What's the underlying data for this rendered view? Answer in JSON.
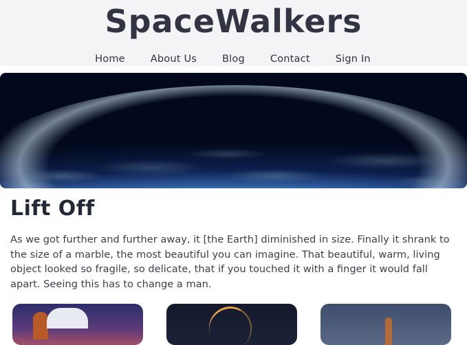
{
  "header": {
    "logo": "SpaceWalkers",
    "nav": [
      "Home",
      "About Us",
      "Blog",
      "Contact",
      "Sign In"
    ]
  },
  "hero": {
    "image": "earth-from-space"
  },
  "article": {
    "title": "Lift Off",
    "body": "As we got further and further away, it [the Earth] diminished in size. Finally it shrank to the size of a marble, the most beautiful you can imagine. That beautiful, warm, living object looked so fragile, so delicate, that if you touched it with a finger it would fall apart. Seeing this has to change a man."
  },
  "cards": [
    {
      "image": "space-shuttle-launch"
    },
    {
      "image": "night-launch-arc"
    },
    {
      "image": "rocket-on-pad"
    }
  ]
}
